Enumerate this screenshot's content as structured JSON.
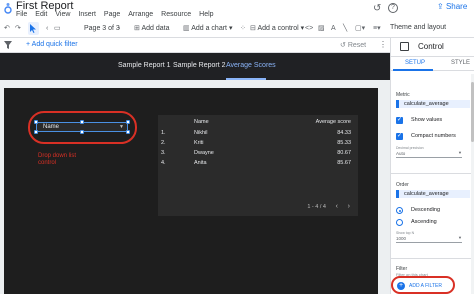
{
  "app": {
    "title": "First Report"
  },
  "menu": [
    "File",
    "Edit",
    "View",
    "Insert",
    "Page",
    "Arrange",
    "Resource",
    "Help"
  ],
  "header": {
    "share_label": "Share"
  },
  "toolbar": {
    "page_indicator": "Page 3 of 3",
    "add_data": "Add data",
    "add_chart": "Add a chart",
    "add_control": "Add a control",
    "theme_layout": "Theme and layout"
  },
  "filter_bar": {
    "add_quick_filter": "+ Add quick filter",
    "reset": "Reset"
  },
  "page_tabs": [
    "Sample Report 1",
    "Sample Report 2",
    "Average Scores"
  ],
  "active_page_tab": 2,
  "dropdown_control": {
    "label": "Name"
  },
  "annotation": {
    "text": "Drop down list control"
  },
  "table": {
    "headers": [
      "Name",
      "Average score"
    ],
    "rows": [
      {
        "idx": "1.",
        "name": "Nikhil",
        "score": "84.33"
      },
      {
        "idx": "2.",
        "name": "Kriti",
        "score": "85.33"
      },
      {
        "idx": "3.",
        "name": "Dwayne",
        "score": "80.67"
      },
      {
        "idx": "4.",
        "name": "Anita",
        "score": "85.67"
      }
    ],
    "pagination": "1 - 4 / 4"
  },
  "panel": {
    "title": "Control",
    "tabs": [
      "SETUP",
      "STYLE"
    ],
    "active_tab": "SETUP",
    "metric_label": "Metric",
    "metric_value": "calculate_average",
    "show_values": "Show values",
    "compact_numbers": "Compact numbers",
    "decimal_label": "Decimal precision",
    "decimal_value": "Auto",
    "order_label": "Order",
    "order_value": "calculate_average",
    "descending": "Descending",
    "ascending": "Ascending",
    "show_top_label": "Show top N",
    "show_top_value": "1000",
    "filter_label": "Filter",
    "filter_sub": "Filter on this chart",
    "add_filter": "ADD A FILTER"
  },
  "colors": {
    "accent": "#1a73e8",
    "annotation": "#d93025",
    "report_bg": "#1e1e1e",
    "tab_active": "#8ab4f8"
  }
}
